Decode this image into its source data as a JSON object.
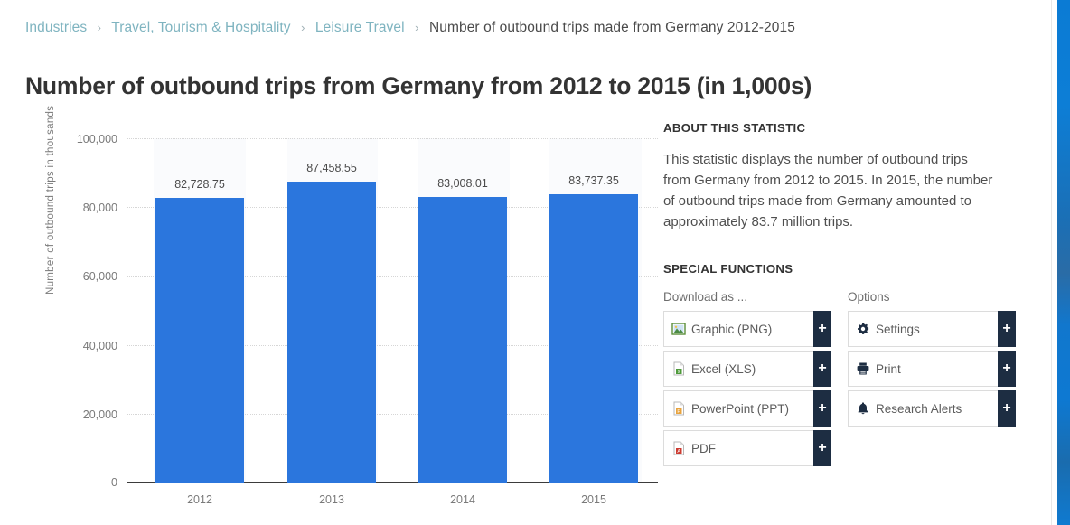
{
  "breadcrumb": {
    "separator": "›",
    "items": [
      {
        "label": "Industries",
        "link": true
      },
      {
        "label": "Travel, Tourism & Hospitality",
        "link": true
      },
      {
        "label": "Leisure Travel",
        "link": true
      },
      {
        "label": "Number of outbound trips made from Germany 2012-2015",
        "link": false
      }
    ]
  },
  "title": "Number of outbound trips from Germany from 2012 to 2015 (in 1,000s)",
  "chart_data": {
    "type": "bar",
    "title": "Number of outbound trips from Germany from 2012 to 2015 (in 1,000s)",
    "categories": [
      "2012",
      "2013",
      "2014",
      "2015"
    ],
    "values": [
      82728.75,
      87458.55,
      83008.01,
      83737.35
    ],
    "data_labels": [
      "82,728.75",
      "87,458.55",
      "83,008.01",
      "83,737.35"
    ],
    "xlabel": "",
    "ylabel": "Number of outbound trips in thousands",
    "ylim": [
      0,
      100000
    ],
    "yticks": [
      0,
      20000,
      40000,
      60000,
      80000,
      100000
    ],
    "ytick_labels": [
      "0",
      "20,000",
      "40,000",
      "60,000",
      "80,000",
      "100,000"
    ],
    "grid": true,
    "legend": false,
    "bar_color": "#2b76dd"
  },
  "sidebar": {
    "about": {
      "heading": "ABOUT THIS STATISTIC",
      "text": "This statistic displays the number of outbound trips from Germany from 2012 to 2015. In 2015, the number of outbound trips made from Germany amounted to approximately 83.7 million trips."
    },
    "special_functions": {
      "heading": "SPECIAL FUNCTIONS",
      "download_label": "Download as ...",
      "options_label": "Options",
      "plus_label": "+",
      "downloads": [
        {
          "label": "Graphic (PNG)",
          "icon": "png-image-icon"
        },
        {
          "label": "Excel (XLS)",
          "icon": "xls-file-icon"
        },
        {
          "label": "PowerPoint (PPT)",
          "icon": "ppt-file-icon"
        },
        {
          "label": "PDF",
          "icon": "pdf-file-icon"
        }
      ],
      "options": [
        {
          "label": "Settings",
          "icon": "gear-icon"
        },
        {
          "label": "Print",
          "icon": "printer-icon"
        },
        {
          "label": "Research Alerts",
          "icon": "bell-icon"
        }
      ]
    }
  },
  "colors": {
    "bar": "#2b76dd",
    "accent_dark": "#1d2d42",
    "breadcrumb_link": "#7fb4c0",
    "right_strip": "#0d7ed6"
  }
}
